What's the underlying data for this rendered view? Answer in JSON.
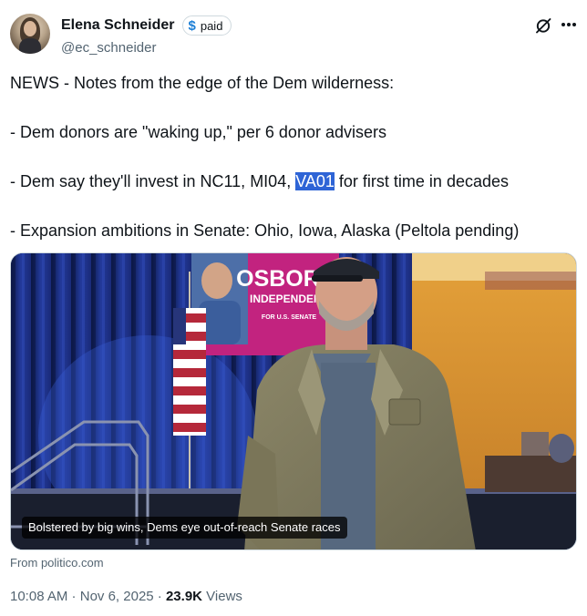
{
  "author": {
    "display_name": "Elena Schneider",
    "handle": "@ec_schneider",
    "badge_label": "paid",
    "badge_symbol": "$"
  },
  "tweet": {
    "line1": "NEWS - Notes from the edge of the Dem wilderness:",
    "line2": "- Dem donors are \"waking up,\" per 6 donor advisers",
    "line3_before": "- Dem say they'll invest in NC11, MI04, ",
    "line3_highlight": "VA01",
    "line3_after": " for first time in decades",
    "line4": "- Expansion ambitions in Senate: Ohio, Iowa, Alaska (Peltola pending)"
  },
  "media": {
    "sign_title": "OSBORN",
    "sign_subtitle": "INDEPENDENT",
    "sign_small": "FOR U.S. SENATE",
    "caption": "Bolstered by big wins, Dems eye out-of-reach Senate races"
  },
  "source": "From politico.com",
  "meta": {
    "time": "10:08 AM",
    "separator": " · ",
    "date": "Nov 6, 2025",
    "views_count": "23.9K",
    "views_label": "Views"
  },
  "colors": {
    "text": "#0f1419",
    "secondary": "#536471",
    "highlight": "#2e64d6",
    "badge_dollar": "#1d7fd6",
    "sign_magenta": "#c2237f"
  },
  "icons": [
    "grok-icon",
    "more-icon",
    "avatar"
  ]
}
